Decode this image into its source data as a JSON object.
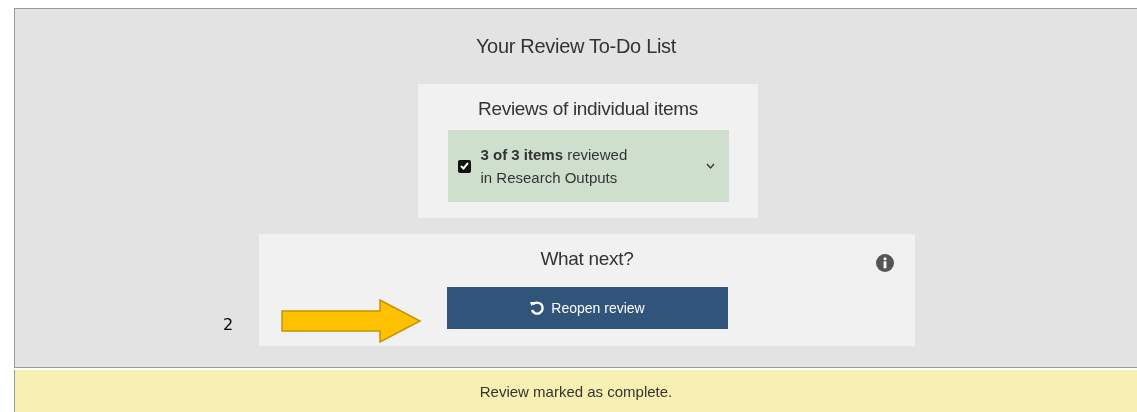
{
  "panel": {
    "title": "Your Review To-Do List"
  },
  "items_card": {
    "heading": "Reviews of individual items",
    "summary": {
      "checked": true,
      "line_1": "**3 of 3 items** reviewed",
      "line_2": "in Research Outputs",
      "expanded": false
    }
  },
  "next_card": {
    "heading": "What next?",
    "button": "Reopen review"
  },
  "annotation": {
    "number": "2"
  },
  "banner": {
    "message": "Review marked as complete."
  }
}
